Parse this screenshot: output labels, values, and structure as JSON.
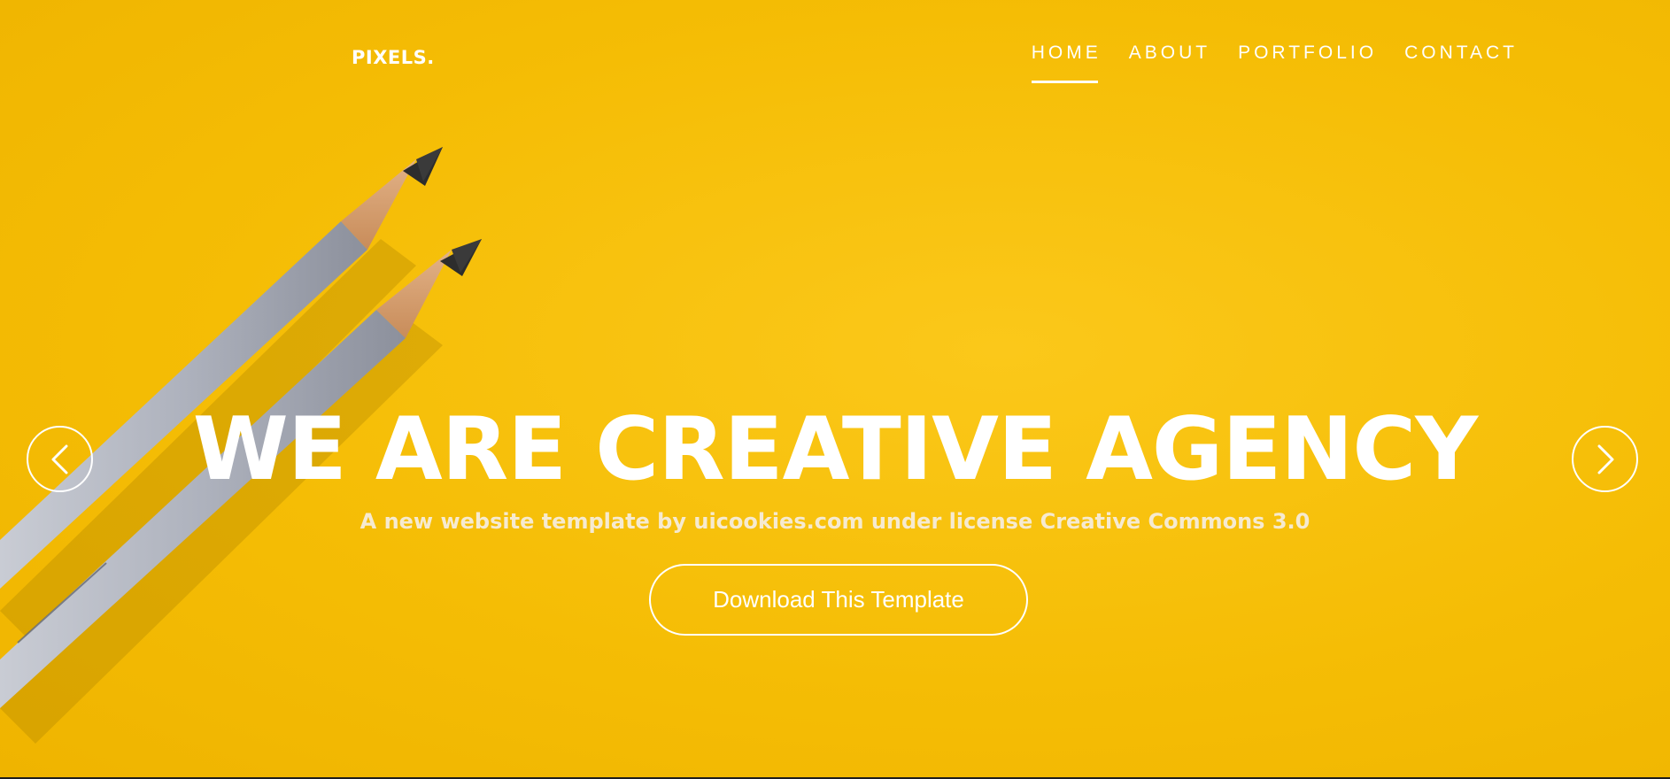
{
  "brand": {
    "name": "PIXELS."
  },
  "nav": {
    "items": [
      {
        "label": "HOME",
        "active": true
      },
      {
        "label": "ABOUT",
        "active": false
      },
      {
        "label": "PORTFOLIO",
        "active": false
      },
      {
        "label": "CONTACT",
        "active": false
      }
    ]
  },
  "hero": {
    "headline": "WE ARE CREATIVE AGENCY",
    "subtitle": "A new website template by uicookies.com under license Creative Commons 3.0",
    "cta_label": "Download This Template",
    "image_icon": "pencils-photo",
    "background_color": "#f5bd05"
  },
  "slider": {
    "prev_icon": "chevron-left-icon",
    "next_icon": "chevron-right-icon"
  },
  "colors": {
    "text": "#ffffff",
    "accent": "#f5bd05"
  }
}
